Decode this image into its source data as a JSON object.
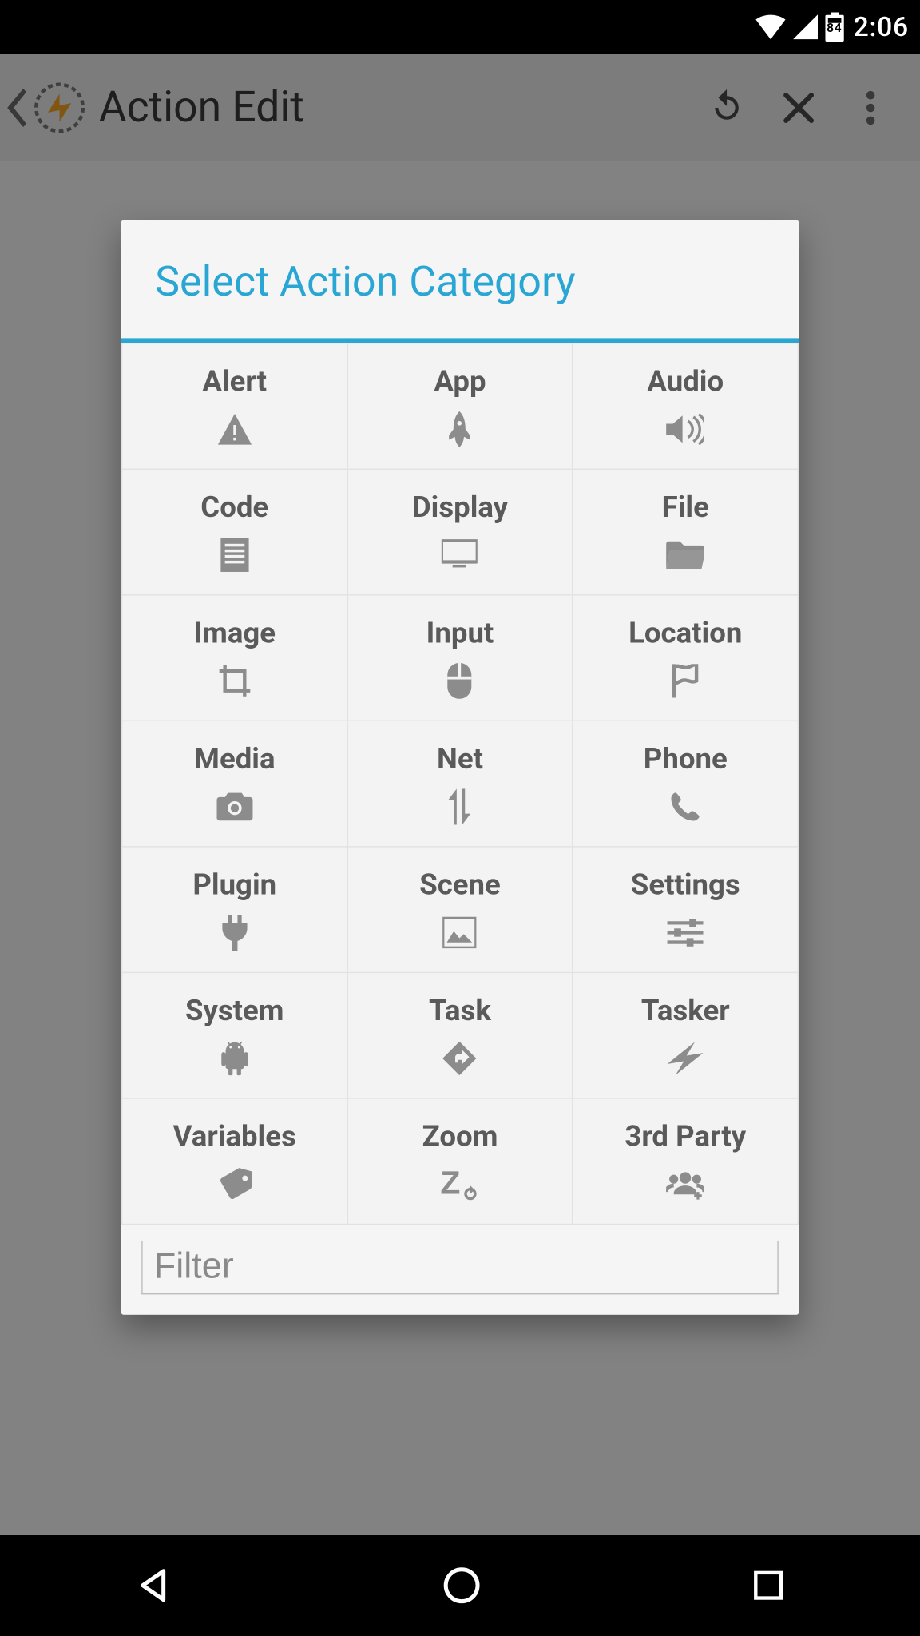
{
  "status_bar": {
    "clock": "2:06",
    "battery_pct": "84"
  },
  "app_bar": {
    "title": "Action Edit"
  },
  "dialog": {
    "title": "Select Action Category",
    "filter_placeholder": "Filter",
    "cells": {
      "alert": {
        "label": "Alert"
      },
      "app": {
        "label": "App"
      },
      "audio": {
        "label": "Audio"
      },
      "code": {
        "label": "Code"
      },
      "display": {
        "label": "Display"
      },
      "file": {
        "label": "File"
      },
      "image": {
        "label": "Image"
      },
      "input": {
        "label": "Input"
      },
      "location": {
        "label": "Location"
      },
      "media": {
        "label": "Media"
      },
      "net": {
        "label": "Net"
      },
      "phone": {
        "label": "Phone"
      },
      "plugin": {
        "label": "Plugin"
      },
      "scene": {
        "label": "Scene"
      },
      "settings": {
        "label": "Settings"
      },
      "system": {
        "label": "System"
      },
      "task": {
        "label": "Task"
      },
      "tasker": {
        "label": "Tasker"
      },
      "variables": {
        "label": "Variables"
      },
      "zoom": {
        "label": "Zoom"
      },
      "thirdparty": {
        "label": "3rd Party"
      }
    }
  }
}
